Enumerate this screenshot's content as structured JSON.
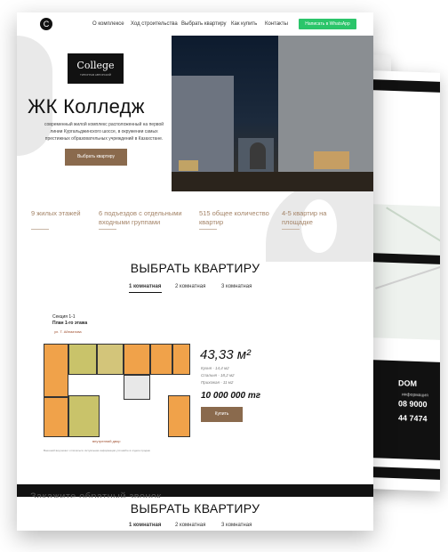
{
  "nav": {
    "logo_glyph": "C",
    "links": [
      "О комплексе",
      "Ход строительства",
      "Выбрать квартиру",
      "Как купить",
      "Контакты"
    ],
    "whatsapp_label": "Написать в WhatsApp"
  },
  "hero": {
    "logo_title": "College",
    "logo_subtitle": "ТИПОГРАФ АВТОРСКИЙ",
    "title": "ЖК Колледж",
    "description": "современный жилой комплекс расположенный на первой линии Кургальджинского шоссе, в окружении самых престижных образовательных учреждений в Казахстане.",
    "cta_label": "Выбрать квартиру"
  },
  "features": [
    "9 жилых этажей",
    "6 подъездов с отдельными входными группами",
    "515 общее количество квартир",
    "4-5 квартир на площадке"
  ],
  "choose": {
    "title": "ВЫБРАТЬ КВАРТИРУ",
    "tabs": [
      "1 комнатная",
      "2 комнатная",
      "3 комнатная"
    ],
    "active_tab": 0
  },
  "plan": {
    "section_label": "Секция 1-1",
    "floor_label": "План 1-го этажа",
    "street_label": "ул. Т. Айтматова",
    "yard_label": "внутренний двор",
    "note": "Внешний вид может отличаться. Актуальная информация уточняйте в отделе продаж"
  },
  "apartment": {
    "area": "43,33 м²",
    "kitchen": "Кухня - 14,4 м2",
    "bedroom": "Спальня - 18,2 м2",
    "hall": "Прихожая - 11 м2",
    "price": "10 000 000 тг",
    "buy_label": "Купить"
  },
  "callback": {
    "title": "Закажите обратный звонок"
  },
  "choose2": {
    "title": "ВЫБРАТЬ КВАРТИРУ",
    "tabs": [
      "1 комнатная",
      "2 комнатная",
      "3 комнатная"
    ]
  },
  "background_page": {
    "brand": "DOM",
    "phone1": "08 9000",
    "phone2": "44 7474",
    "contact_label": "информация"
  },
  "colors": {
    "accent_brown": "#8a6a4d",
    "feature_text": "#a48468",
    "whatsapp_green": "#2bc56a",
    "dark": "#111111"
  }
}
